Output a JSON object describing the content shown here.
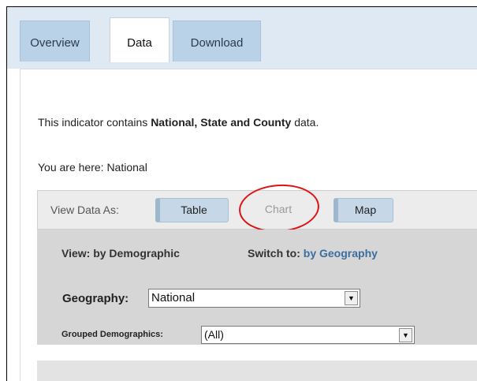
{
  "tabs": {
    "overview": "Overview",
    "data": "Data",
    "download": "Download"
  },
  "intro": {
    "prefix": "This indicator contains ",
    "bold": "National, State and County",
    "suffix": " data."
  },
  "breadcrumb": "You are here: National",
  "view_as": {
    "label": "View Data As:",
    "table": "Table",
    "chart": "Chart",
    "map": "Map"
  },
  "view": {
    "label": "View: by Demographic",
    "switch_label": "Switch to:",
    "switch_link": "by Geography"
  },
  "geography": {
    "label": "Geography:",
    "value": "National"
  },
  "grouped": {
    "label": "Grouped Demographics:",
    "value": "(All)"
  },
  "colors": {
    "tab_bg": "#b9d2e7",
    "header_bg": "#dfe9f3",
    "link": "#3b6ea0",
    "highlight_ring": "#e01212"
  }
}
